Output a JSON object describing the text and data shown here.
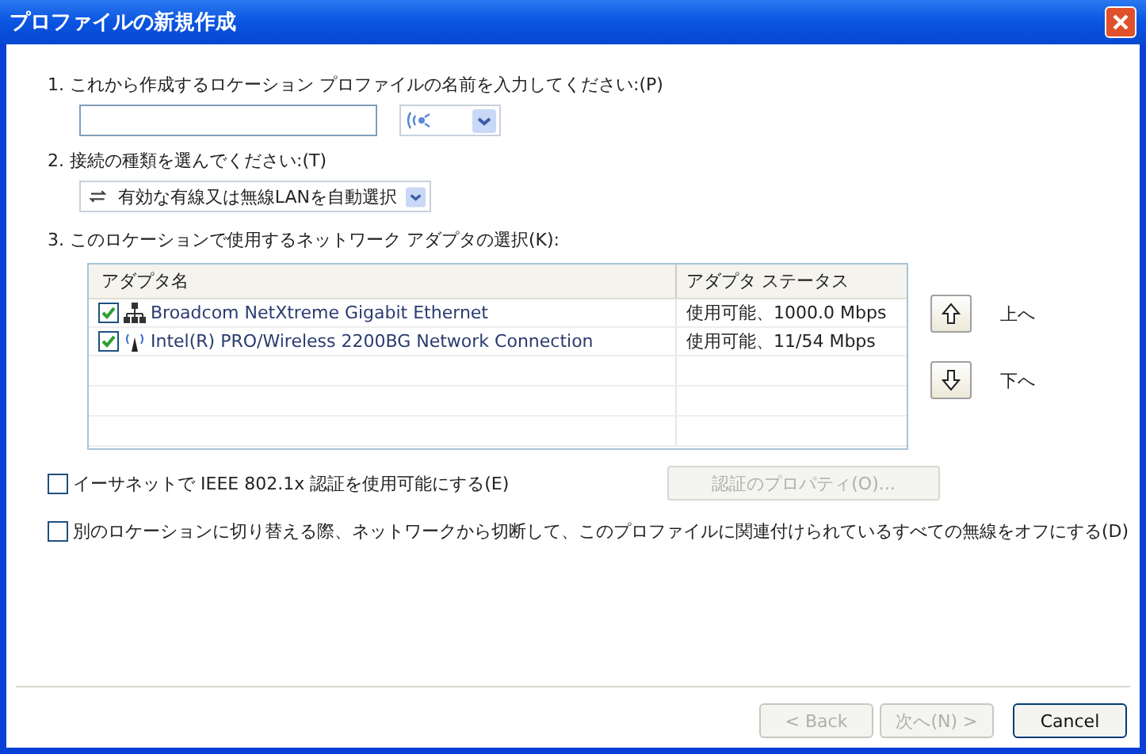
{
  "window": {
    "title": "プロファイルの新規作成"
  },
  "step1": {
    "label": "1. これから作成するロケーション プロファイルの名前を入力してください:(P)"
  },
  "step2": {
    "label": "2. 接続の種類を選んでください:(T)",
    "connection_type": "有効な有線又は無線LANを自動選択"
  },
  "step3": {
    "label": "3. このロケーションで使用するネットワーク アダプタの選択(K):"
  },
  "table": {
    "columns": [
      "アダプタ名",
      "アダプタ ステータス"
    ],
    "rows": [
      {
        "kind": "wired",
        "checked": true,
        "name": "Broadcom NetXtreme Gigabit Ethernet",
        "status": "使用可能、1000.0 Mbps"
      },
      {
        "kind": "wireless",
        "checked": true,
        "name": "Intel(R) PRO/Wireless 2200BG Network Connection",
        "status": "使用可能、11/54 Mbps"
      }
    ]
  },
  "move_buttons": [
    {
      "kind": "up",
      "label": "上へ"
    },
    {
      "kind": "down",
      "label": "下へ"
    }
  ],
  "options": [
    {
      "label": "イーサネットで IEEE 802.1x 認証を使用可能にする(E)",
      "checked": false
    },
    {
      "label": "別のロケーションに切り替える際、ネットワークから切断して、このプロファイルに関連付けられているすべての無線をオフにする(D)",
      "checked": false
    }
  ],
  "auth_button": {
    "label": "認証のプロパティ(O)...",
    "disabled": true
  },
  "buttons": [
    {
      "label": "< Back",
      "disabled": true
    },
    {
      "label": "次へ(N) >",
      "disabled": true
    },
    {
      "label": "Cancel",
      "disabled": false
    }
  ]
}
